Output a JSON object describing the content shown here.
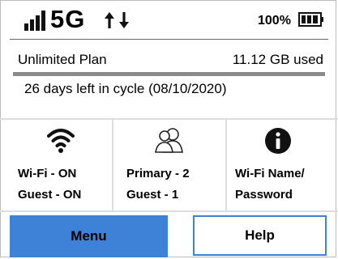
{
  "status": {
    "network": "5G",
    "battery_text": "100%",
    "icons": [
      "signal-icon",
      "updown-arrows-icon",
      "battery-icon"
    ]
  },
  "plan": {
    "name": "Unlimited Plan",
    "used": "11.12 GB used",
    "cycle": "26 days left in cycle (08/10/2020)"
  },
  "tiles": [
    {
      "icon": "wifi-icon",
      "line1": "Wi-Fi - ON",
      "line2": "Guest - ON"
    },
    {
      "icon": "users-icon",
      "line1": "Primary - 2",
      "line2": "Guest - 1"
    },
    {
      "icon": "info-icon",
      "line1": "Wi-Fi Name/",
      "line2": "Password"
    }
  ],
  "buttons": {
    "menu": "Menu",
    "help": "Help"
  },
  "colors": {
    "accent": "#3d82d6",
    "divider": "#dddddd"
  }
}
